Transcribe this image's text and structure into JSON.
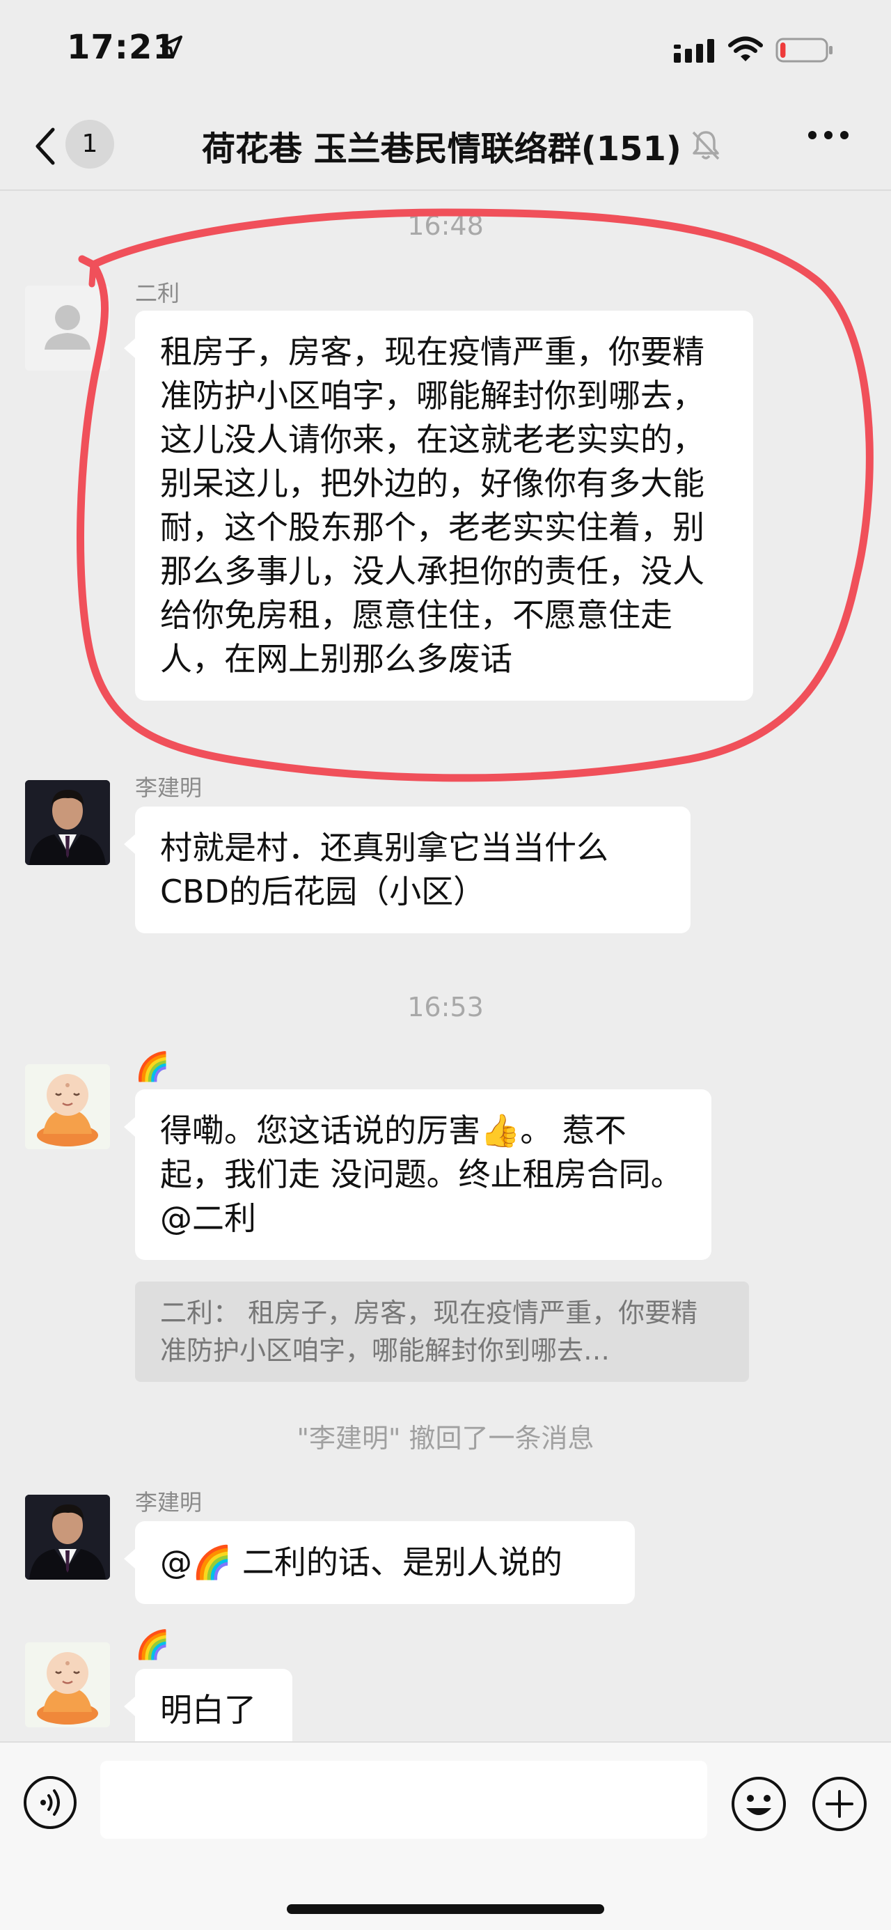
{
  "status_bar": {
    "time": "17:21",
    "battery_level": 0.12
  },
  "header": {
    "unread_count": "1",
    "title": "荷花巷 玉兰巷民情联络群(151)"
  },
  "messages": [
    {
      "type": "timestamp",
      "text": "16:48"
    },
    {
      "type": "message",
      "sender": "二利",
      "avatar": "default-avatar",
      "text": " 租房子，房客，现在疫情严重，你要精准防护小区咱字，哪能解封你到哪去，这儿没人请你来，在这就老老实实的，别呆这儿，把外边的，好像你有多大能耐，这个股东那个，老老实实住着，别那么多事儿，没人承担你的责任，没人给你免房租，愿意住住，不愿意住走人，在网上别那么多废话"
    },
    {
      "type": "message",
      "sender": "李建明",
      "avatar": "man-in-suit-avatar",
      "text": "村就是村．还真别拿它当当什么CBD的后花园（小区）"
    },
    {
      "type": "timestamp",
      "text": "16:53"
    },
    {
      "type": "message",
      "sender": "🌈",
      "avatar": "buddha-avatar",
      "text": "得嘞。您这话说的厉害👍。 惹不起，我们走 没问题。终止租房合同。@二利",
      "quote": "二利： 租房子，房客，现在疫情严重，你要精准防护小区咱字，哪能解封你到哪去…"
    },
    {
      "type": "system",
      "text": "\"李建明\" 撤回了一条消息"
    },
    {
      "type": "message",
      "sender": "李建明",
      "avatar": "man-in-suit-avatar",
      "text": "@🌈 二利的话、是别人说的"
    },
    {
      "type": "message",
      "sender": "🌈",
      "avatar": "buddha-avatar",
      "text": "明白了"
    }
  ],
  "input": {
    "placeholder": ""
  },
  "colors": {
    "background": "#ededed",
    "bubble": "#ffffff",
    "highlight_circle": "#f0505a"
  }
}
